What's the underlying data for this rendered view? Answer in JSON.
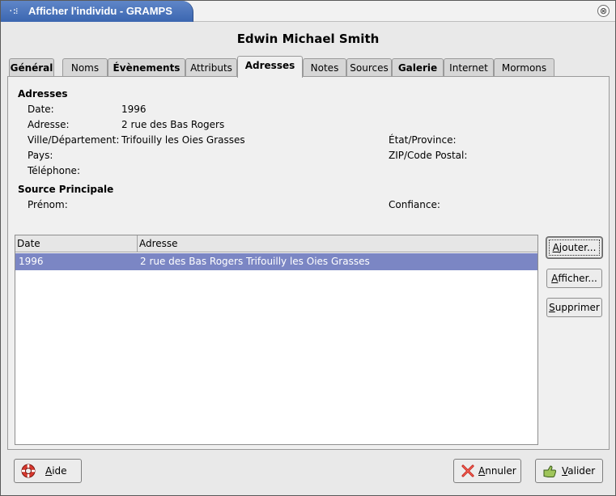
{
  "window": {
    "title": "Afficher l'individu - GRAMPS",
    "title_icon": "grid-dots-icon",
    "close_symbol": "⊗"
  },
  "person_name": "Edwin Michael Smith",
  "tabs": [
    {
      "label": "Général"
    },
    {
      "label": "Noms"
    },
    {
      "label": "Évènements"
    },
    {
      "label": "Attributs"
    },
    {
      "label": "Adresses"
    },
    {
      "label": "Notes"
    },
    {
      "label": "Sources"
    },
    {
      "label": "Galerie"
    },
    {
      "label": "Internet"
    },
    {
      "label": "Mormons"
    }
  ],
  "active_tab": "Adresses",
  "details": {
    "section_title": "Adresses",
    "date_label": "Date:",
    "date_value": "1996",
    "address_label": "Adresse:",
    "address_value": "2 rue des Bas Rogers",
    "city_label": "Ville/Département:",
    "city_value": "Trifouilly les Oies Grasses",
    "state_label": "État/Province:",
    "state_value": "",
    "country_label": "Pays:",
    "country_value": "",
    "zip_label": "ZIP/Code Postal:",
    "zip_value": "",
    "phone_label": "Téléphone:",
    "phone_value": ""
  },
  "source": {
    "section_title": "Source Principale",
    "first_name_label": "Prénom:",
    "confidence_label": "Confiance:"
  },
  "list": {
    "columns": [
      "Date",
      "Adresse"
    ],
    "rows": [
      {
        "date": "1996",
        "address": "2 rue des Bas Rogers Trifouilly les Oies Grasses"
      }
    ],
    "selected_color": "#7b86c4"
  },
  "side_buttons": {
    "add": {
      "key": "A",
      "rest": "jouter..."
    },
    "view": {
      "key": "A",
      "rest": "fficher..."
    },
    "delete": {
      "key": "S",
      "rest": "upprimer"
    }
  },
  "bottom_buttons": {
    "help": {
      "key": "A",
      "rest": "ide",
      "icon": "lifebuoy-icon"
    },
    "cancel": {
      "key": "A",
      "rest": "nnuler",
      "icon": "red-x-icon"
    },
    "ok": {
      "key": "V",
      "rest": "alider",
      "icon": "hand-ok-icon"
    }
  }
}
